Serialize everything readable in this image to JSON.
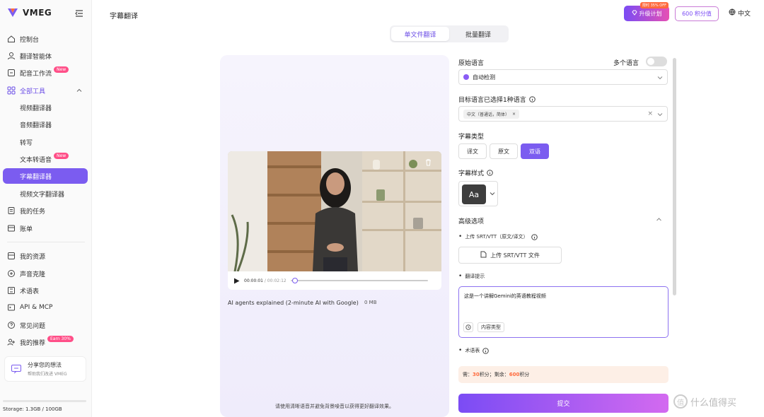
{
  "app": {
    "name": "VMEG",
    "brand_color": "#7b5cf0"
  },
  "sidebar": {
    "items": [
      {
        "label": "控制台",
        "icon": "home-icon"
      },
      {
        "label": "翻译智能体",
        "icon": "agent-icon"
      },
      {
        "label": "配音工作流",
        "icon": "workflow-icon",
        "badge": "New"
      },
      {
        "label": "全部工具",
        "icon": "grid-icon"
      },
      {
        "label": "视频翻译器"
      },
      {
        "label": "音频翻译器"
      },
      {
        "label": "转写"
      },
      {
        "label": "文本转语音",
        "badge": "New"
      },
      {
        "label": "字幕翻译器"
      },
      {
        "label": "视频文字翻译器"
      },
      {
        "label": "我的任务",
        "icon": "task-icon"
      },
      {
        "label": "账单",
        "icon": "bill-icon"
      },
      {
        "label": "我的资源",
        "icon": "resource-icon"
      },
      {
        "label": "声音克隆",
        "icon": "voice-icon"
      },
      {
        "label": "术语表",
        "icon": "glossary-icon"
      },
      {
        "label": "API & MCP",
        "icon": "api-icon"
      },
      {
        "label": "常见问题",
        "icon": "help-icon"
      },
      {
        "label": "我的推荐",
        "icon": "referral-icon",
        "badge": "Earn 30%"
      }
    ],
    "share": {
      "title": "分享您的想法",
      "subtitle": "帮助我们改进 VMEG"
    },
    "storage": "Storage: 1.3GB / 100GB"
  },
  "header": {
    "title": "字幕翻译",
    "upgrade_label": "升级计划",
    "upgrade_tag": "限时 35% OFF",
    "credits_label": "600 积分值",
    "language": "中文"
  },
  "tabs": [
    {
      "label": "单文件翻译"
    },
    {
      "label": "批量翻译"
    }
  ],
  "preview": {
    "current_time": "00:00:01",
    "total_time": "/ 00:02:12",
    "progress": 0.01,
    "file_name": "AI agents explained (2-minute AI with Google)",
    "file_size": "0 MB",
    "tip": "请使用清晰语音并避免背景噪音以获得更好翻译效果。"
  },
  "settings": {
    "source_lang_label": "原始语言",
    "multi_lang_label": "多个语言",
    "source_lang_value": "自动检测",
    "target_lang_label": "目标语言已选择1种语言",
    "target_lang_chip": "中文（普通话，简体）",
    "subtitle_type_label": "字幕类型",
    "subtitle_types": [
      "译文",
      "原文",
      "双语"
    ],
    "subtitle_style_label": "字幕样式",
    "style_preview": "Aa",
    "advanced_label": "高级选项",
    "upload_label": "上传 SRT/VTT（原文/译文）",
    "upload_button": "上传 SRT/VTT 文件",
    "hint_label": "翻译提示",
    "hint_value": "这是一个讲解Gemini的英语教程视频",
    "content_type": "内容类型",
    "glossary_label": "术语表",
    "cost_prefix": "需：",
    "cost_value": "30",
    "cost_mid": "积分；剩余：",
    "remaining_value": "600",
    "cost_suffix": "积分",
    "submit": "提交"
  },
  "watermark": "什么值得买"
}
